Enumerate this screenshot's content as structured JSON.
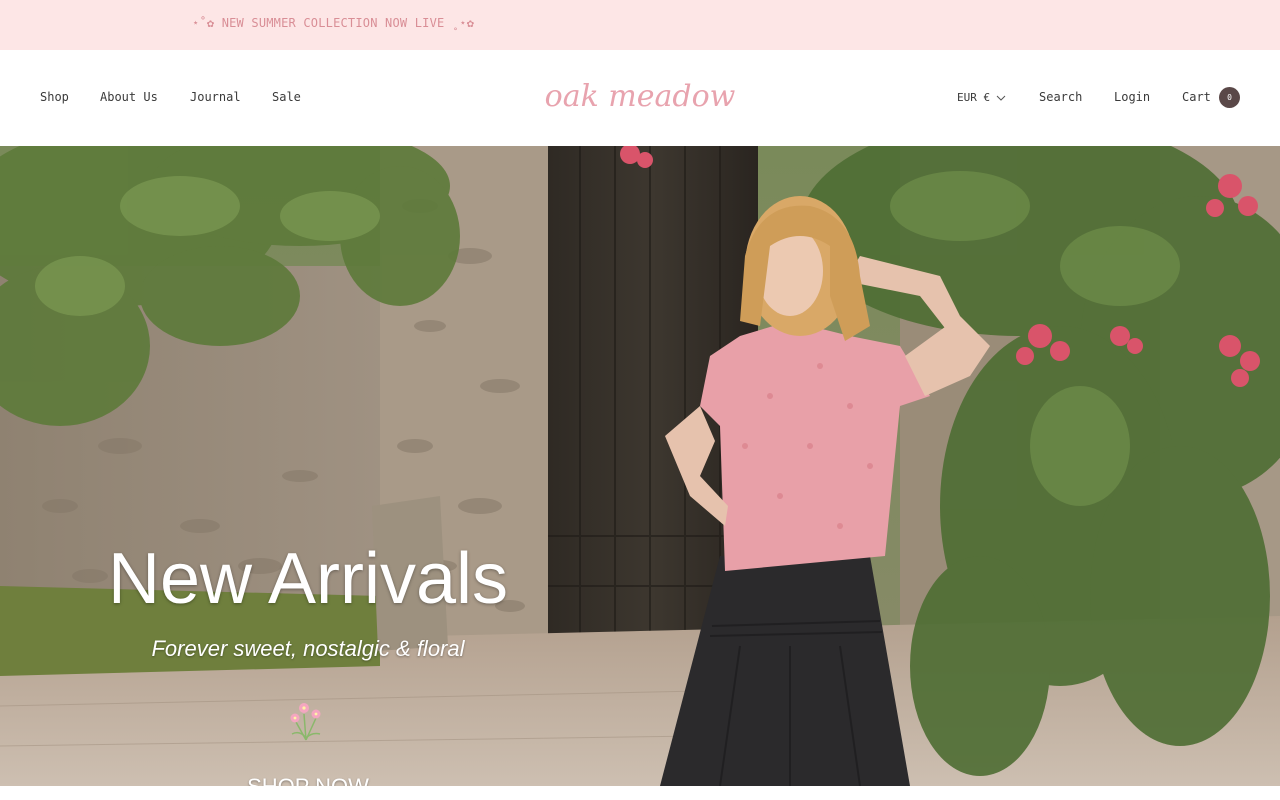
{
  "announcement": {
    "text": "⋆˚✿ NEW SUMMER COLLECTION NOW LIVE ˳⋆✿"
  },
  "header": {
    "nav_left": [
      {
        "label": "Shop"
      },
      {
        "label": "About Us"
      },
      {
        "label": "Journal"
      },
      {
        "label": "Sale"
      }
    ],
    "logo_text": "oak meadow",
    "currency": "EUR €",
    "search_label": "Search",
    "login_label": "Login",
    "cart_label": "Cart",
    "cart_count": "0"
  },
  "hero": {
    "title": "New Arrivals",
    "subtitle": "Forever sweet, nostalgic & floral",
    "cta": "SHOP NOW",
    "icon": "flower-icon"
  },
  "colors": {
    "announcement_bg": "#fde6e6",
    "announcement_text": "#d98e96",
    "logo": "#e8a3ae",
    "cart_badge": "#5a4848"
  }
}
